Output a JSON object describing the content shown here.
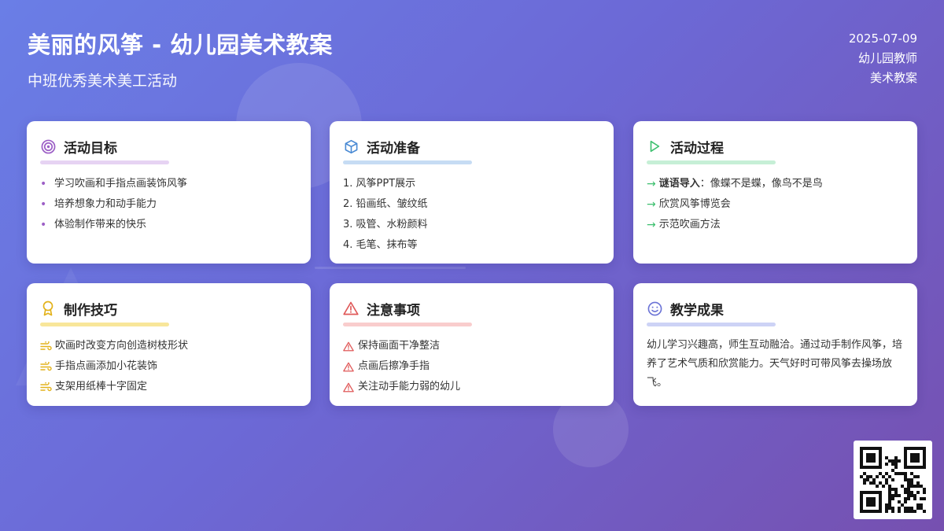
{
  "header": {
    "title": "美丽的风筝 - 幼儿园美术教案",
    "subtitle": "中班优秀美术美工活动",
    "date": "2025-07-09",
    "author": "幼儿园教师",
    "category": "美术教案"
  },
  "cards": {
    "goals": {
      "title": "活动目标",
      "icon": "target-icon",
      "color": "#9c5fc6",
      "items": [
        "学习吹画和手指点画装饰风筝",
        "培养想象力和动手能力",
        "体验制作带来的快乐"
      ]
    },
    "prep": {
      "title": "活动准备",
      "icon": "cube-icon",
      "color": "#4a8ad4",
      "items": [
        "1. 风筝PPT展示",
        "2. 铅画纸、皱纹纸",
        "3. 吸管、水粉颜料",
        "4. 毛笔、抹布等"
      ]
    },
    "process": {
      "title": "活动过程",
      "icon": "play-icon",
      "color": "#3cbf6e",
      "items": [
        {
          "strong": "谜语导入",
          "text": "：像蝶不是蝶，像鸟不是鸟"
        },
        {
          "strong": "",
          "text": "欣赏风筝博览会"
        },
        {
          "strong": "",
          "text": "示范吹画方法"
        }
      ]
    },
    "tips": {
      "title": "制作技巧",
      "icon": "award-icon",
      "color": "#e3b21b",
      "items": [
        "吹画时改变方向创造树枝形状",
        "手指点画添加小花装饰",
        "支架用纸棒十字固定"
      ]
    },
    "notes": {
      "title": "注意事项",
      "icon": "warning-icon",
      "color": "#e05a5a",
      "items": [
        "保持画面干净整洁",
        "点画后擦净手指",
        "关注动手能力弱的幼儿"
      ]
    },
    "results": {
      "title": "教学成果",
      "icon": "smile-icon",
      "color": "#6b73d6",
      "text": "幼儿学习兴趣高，师生互动融洽。通过动手制作风筝，培养了艺术气质和欣赏能力。天气好时可带风筝去操场放飞。"
    }
  }
}
